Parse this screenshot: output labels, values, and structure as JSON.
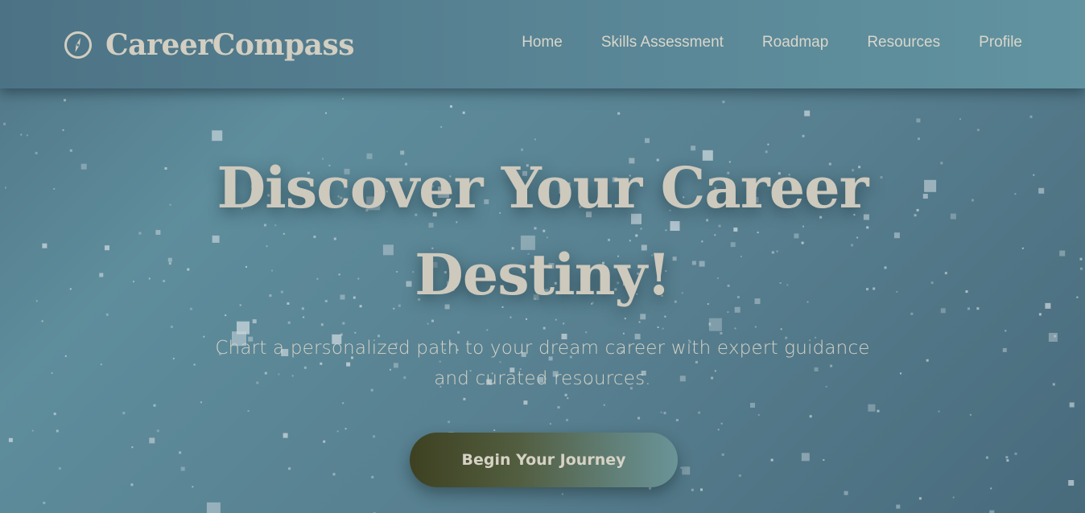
{
  "brand": {
    "name": "CareerCompass",
    "icon": "compass-icon"
  },
  "nav": {
    "items": [
      {
        "label": "Home"
      },
      {
        "label": "Skills Assessment"
      },
      {
        "label": "Roadmap"
      },
      {
        "label": "Resources"
      },
      {
        "label": "Profile"
      }
    ]
  },
  "hero": {
    "title_line1": "Discover Your Career",
    "title_line2": "Destiny!",
    "subtitle_line1": "Chart a personalized path to your dream career with expert guidance",
    "subtitle_line2": "and curated resources.",
    "cta_label": "Begin Your Journey"
  },
  "colors": {
    "background": "#5a8797",
    "header": "#5a8797",
    "text": "#cfccc0",
    "button_start": "#3d4121",
    "button_end": "#6a9498"
  }
}
